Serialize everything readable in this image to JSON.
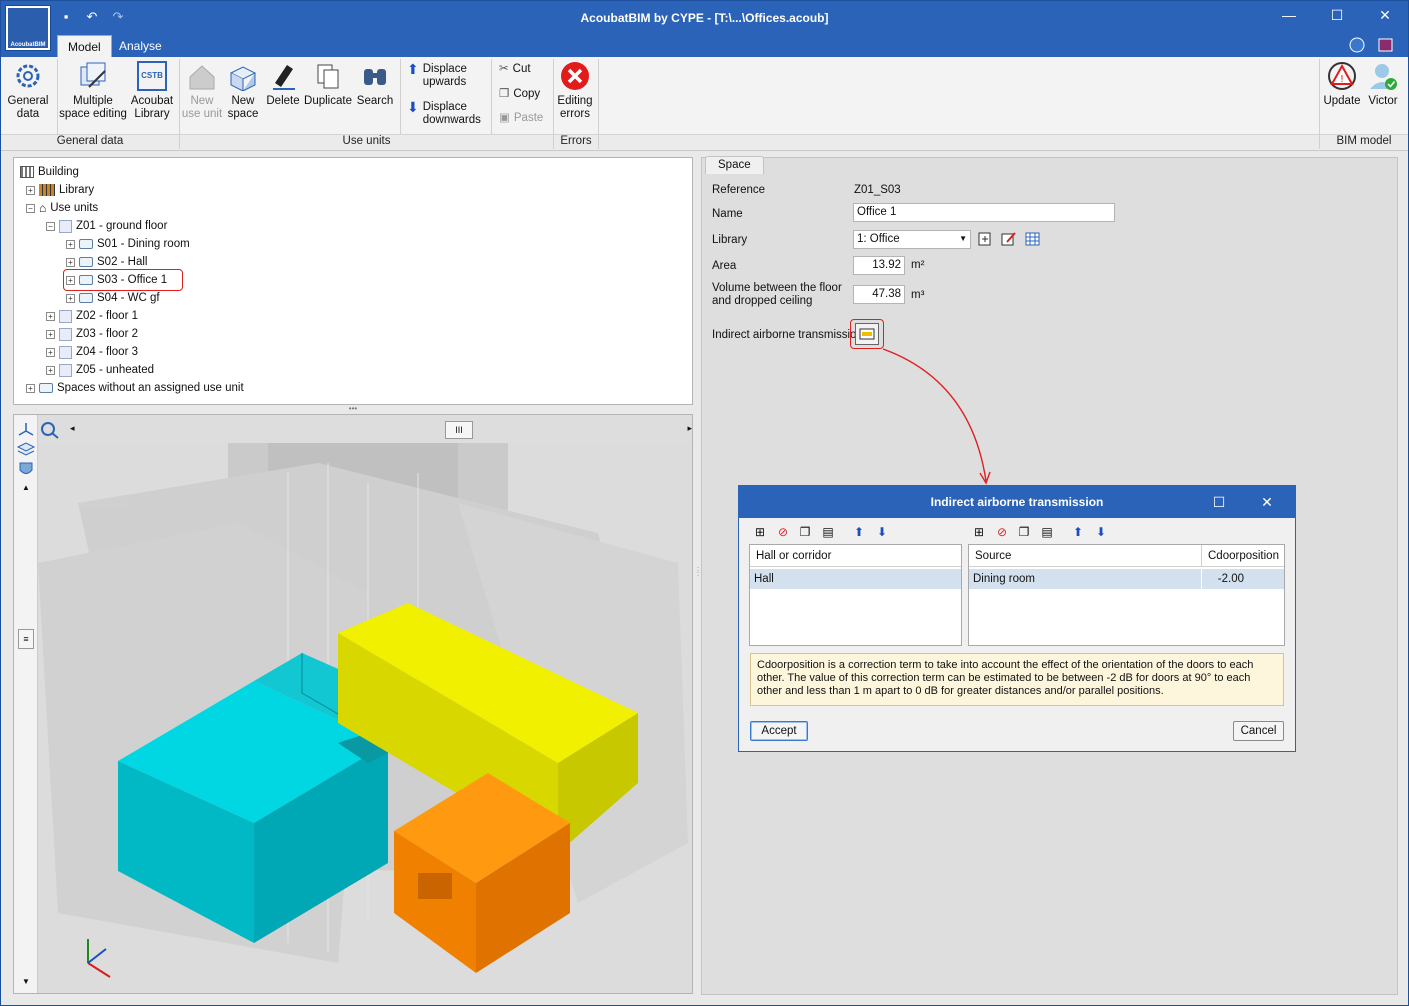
{
  "app": {
    "title": "AcoubatBIM by CYPE - [T:\\...\\Offices.acoub]",
    "logo_text": "AcoubatBIM"
  },
  "tabs": [
    {
      "label": "Model"
    },
    {
      "label": "Analyse"
    }
  ],
  "ribbon": {
    "general_data": "General\ndata",
    "multiple_space_editing": "Multiple\nspace editing",
    "acoubat_library": "Acoubat\nLibrary",
    "cstb": "CSTB",
    "new_use_unit": "New\nuse unit",
    "new_space": "New\nspace",
    "delete": "Delete",
    "duplicate": "Duplicate",
    "search": "Search",
    "displace_upwards": "Displace\nupwards",
    "displace_downwards": "Displace\ndownwards",
    "cut": "Cut",
    "copy": "Copy",
    "paste": "Paste",
    "editing_errors": "Editing\nerrors",
    "update": "Update",
    "user": "Victor",
    "groups": {
      "general": "General data",
      "use_units": "Use units",
      "errors": "Errors",
      "bim": "BIM model"
    }
  },
  "tree": {
    "building": "Building",
    "library": "Library",
    "use_units": "Use units",
    "z01": "Z01 - ground floor",
    "s01": "S01 - Dining room",
    "s02": "S02 - Hall",
    "s03": "S03 - Office 1",
    "s04": "S04 - WC gf",
    "z02": "Z02 - floor 1",
    "z03": "Z03 - floor 2",
    "z04": "Z04 - floor 3",
    "z05": "Z05 - unheated",
    "unassigned": "Spaces without an assigned use unit"
  },
  "space": {
    "tab": "Space",
    "reference_label": "Reference",
    "reference": "Z01_S03",
    "name_label": "Name",
    "name": "Office 1",
    "library_label": "Library",
    "library": "1: Office",
    "area_label": "Area",
    "area": "13.92",
    "area_unit": "m²",
    "volume_label": "Volume between the floor\nand dropped ceiling",
    "volume": "47.38",
    "volume_unit": "m³",
    "indirect_label": "Indirect airborne transmission"
  },
  "dialog": {
    "title": "Indirect airborne transmission",
    "left_header": "Hall or corridor",
    "left_row": "Hall",
    "source_header": "Source",
    "cdoor_header": "Cdoorposition",
    "source_row": "Dining room",
    "cdoor_row": "-2.00",
    "note": "Cdoorposition is a correction term to take into account the effect of the orientation of the doors to each other. The value of this correction term can be estimated to be between -2 dB for doors at 90° to each other and less than 1 m apart to 0 dB for greater distances and/or parallel positions.",
    "accept": "Accept",
    "cancel": "Cancel"
  },
  "colors": {
    "accent": "#2b63b8",
    "cyan": "#00c8d2",
    "yellow": "#e8e800",
    "orange": "#ff8800",
    "highlight": "#e02020"
  }
}
